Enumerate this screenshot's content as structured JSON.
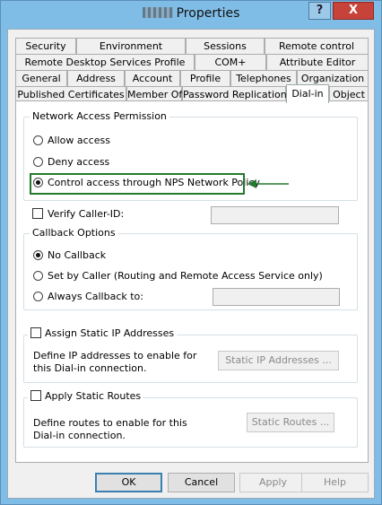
{
  "window": {
    "title": "Properties",
    "help_glyph": "?",
    "close_glyph": "X"
  },
  "tabs": {
    "row1": [
      "Security",
      "Environment",
      "Sessions",
      "Remote control"
    ],
    "row2": [
      "Remote Desktop Services Profile",
      "COM+",
      "Attribute Editor"
    ],
    "row3": [
      "General",
      "Address",
      "Account",
      "Profile",
      "Telephones",
      "Organization"
    ],
    "row4": [
      "Published Certificates",
      "Member Of",
      "Password Replication",
      "Dial-in",
      "Object"
    ],
    "active": "Dial-in"
  },
  "network_access": {
    "legend": "Network Access Permission",
    "allow_label": "Allow access",
    "deny_label": "Deny access",
    "nps_label": "Control access through NPS Network Policy",
    "selected": "nps"
  },
  "verify_caller": {
    "label": "Verify Caller-ID:",
    "checked": false,
    "value": ""
  },
  "callback": {
    "legend": "Callback Options",
    "no_callback_label": "No Callback",
    "set_by_caller_label": "Set by Caller (Routing and Remote Access Service only)",
    "always_label": "Always Callback to:",
    "selected": "no_callback",
    "always_value": ""
  },
  "static_ip": {
    "label": "Assign Static IP Addresses",
    "checked": false,
    "description": "Define IP addresses to enable for this Dial-in connection.",
    "button_label": "Static IP Addresses ..."
  },
  "static_routes": {
    "label": "Apply Static Routes",
    "checked": false,
    "description": "Define routes to enable for this Dial-in connection.",
    "button_label": "Static Routes ..."
  },
  "footer": {
    "ok_label": "OK",
    "cancel_label": "Cancel",
    "apply_label": "Apply",
    "help_label": "Help"
  },
  "annotation": {
    "highlight_color": "#237a2e",
    "arrow_icon": "left-arrow-icon"
  }
}
